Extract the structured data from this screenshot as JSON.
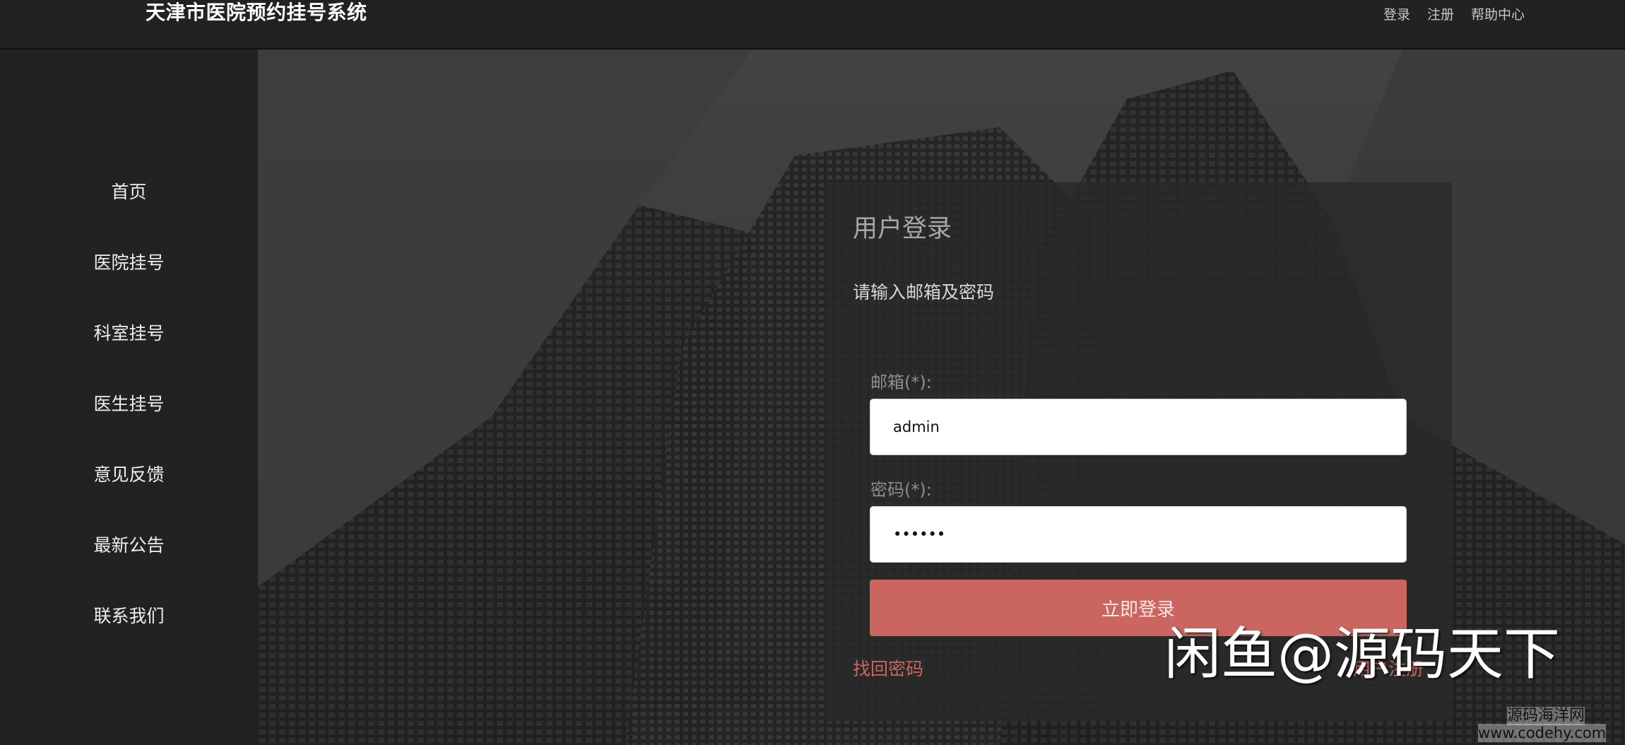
{
  "app": {
    "title": "天津市医院预约挂号系统"
  },
  "topnav": {
    "login": "登录",
    "register": "注册",
    "help": "帮助中心"
  },
  "sidebar": {
    "items": [
      {
        "label": "首页"
      },
      {
        "label": "医院挂号"
      },
      {
        "label": "科室挂号"
      },
      {
        "label": "医生挂号"
      },
      {
        "label": "意见反馈"
      },
      {
        "label": "最新公告"
      },
      {
        "label": "联系我们"
      }
    ]
  },
  "login_panel": {
    "title": "用户登录",
    "hint": "请输入邮箱及密码",
    "email_label": "邮箱(*):",
    "email_value": "admin",
    "password_label": "密码(*):",
    "password_value": "••••••",
    "submit_label": "立即登录",
    "forgot_label": "找回密码",
    "register_label": "用户注册"
  },
  "watermarks": {
    "main": "闲鱼@源码天下",
    "site_name": "源码海洋网",
    "site_url": "www.codehy.com"
  },
  "colors": {
    "header_bg": "#222222",
    "sidebar_bg": "#222222",
    "primary_button": "#cb655f",
    "link": "#c8675f"
  }
}
